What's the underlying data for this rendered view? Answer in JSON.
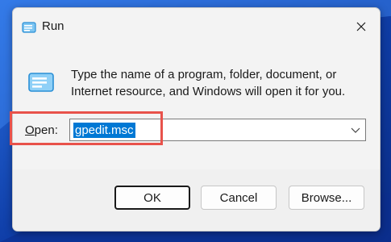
{
  "window": {
    "title": "Run",
    "close_icon": "close-icon"
  },
  "content": {
    "icon": "run-icon",
    "description": "Type the name of a program, folder, document, or Internet resource, and Windows will open it for you."
  },
  "open_field": {
    "label_accel": "O",
    "label_rest": "pen:",
    "value": "gpedit.msc"
  },
  "buttons": {
    "ok": "OK",
    "cancel": "Cancel",
    "browse": "Browse..."
  },
  "colors": {
    "accent": "#0078d4",
    "highlight_annotation": "#e8524b"
  }
}
